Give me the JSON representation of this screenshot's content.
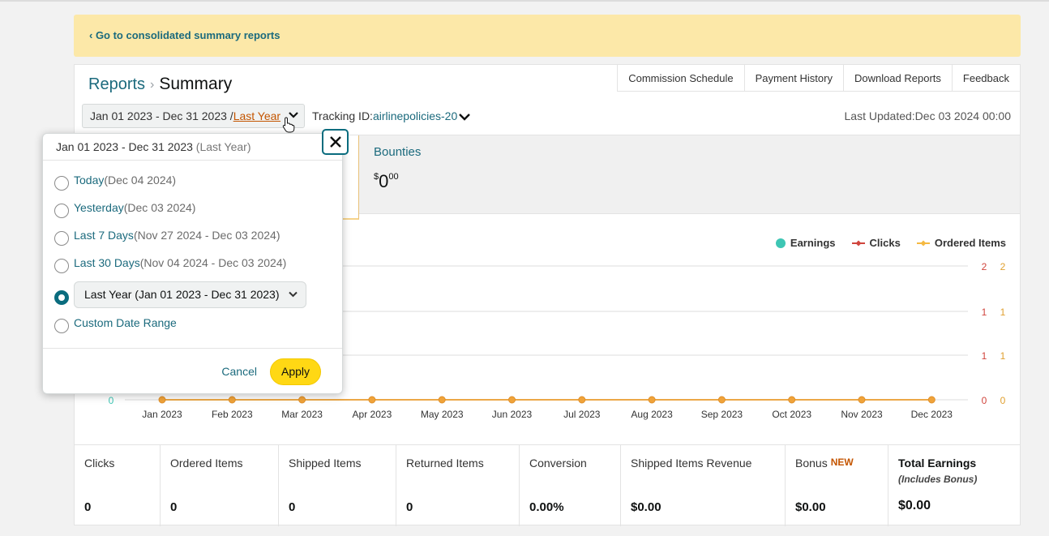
{
  "banner": {
    "link": "‹ Go to consolidated summary reports"
  },
  "breadcrumb": {
    "reports": "Reports",
    "separator": "›",
    "current": "Summary"
  },
  "toplinks": [
    "Commission Schedule",
    "Payment History",
    "Download Reports",
    "Feedback"
  ],
  "date_selector": {
    "range": "Jan 01 2023 - Dec 31 2023 /",
    "preset": "Last Year"
  },
  "tracking": {
    "label": "Tracking ID:",
    "id": "airlinepolicies-20"
  },
  "last_updated": "Last Updated:Dec 03 2024 00:00",
  "bounties": {
    "title": "Bounties",
    "currency": "$",
    "whole": "0",
    "cents": "00"
  },
  "legend": [
    {
      "label": "Earnings",
      "color": "#3ec6b4",
      "icon": "circle-icon"
    },
    {
      "label": "Clicks",
      "color": "#d0453d",
      "icon": "diamond-line-icon"
    },
    {
      "label": "Ordered Items",
      "color": "#f5b942",
      "icon": "diamond-line-icon"
    }
  ],
  "chart_data": {
    "type": "line",
    "categories": [
      "Jan 2023",
      "Feb 2023",
      "Mar 2023",
      "Apr 2023",
      "May 2023",
      "Jun 2023",
      "Jul 2023",
      "Aug 2023",
      "Sep 2023",
      "Oct 2023",
      "Nov 2023",
      "Dec 2023"
    ],
    "series": [
      {
        "name": "Earnings",
        "color": "#3ec6b4",
        "values": [
          0,
          0,
          0,
          0,
          0,
          0,
          0,
          0,
          0,
          0,
          0,
          0
        ]
      },
      {
        "name": "Clicks",
        "color": "#d0453d",
        "values": [
          0,
          0,
          0,
          0,
          0,
          0,
          0,
          0,
          0,
          0,
          0,
          0
        ]
      },
      {
        "name": "Ordered Items",
        "color": "#f5b942",
        "values": [
          0,
          0,
          0,
          0,
          0,
          0,
          0,
          0,
          0,
          0,
          0,
          0
        ]
      }
    ],
    "left_axis_ticks": [
      "0"
    ],
    "right_axis_ticks": [
      {
        "clicks": "2",
        "ordered": "2"
      },
      {
        "clicks": "1",
        "ordered": "1"
      },
      {
        "clicks": "1",
        "ordered": "1"
      },
      {
        "clicks": "0",
        "ordered": "0"
      }
    ],
    "grid": true,
    "legend_position": "top-right"
  },
  "stats": [
    {
      "label": "Clicks",
      "value": "0"
    },
    {
      "label": "Ordered Items",
      "value": "0"
    },
    {
      "label": "Shipped Items",
      "value": "0"
    },
    {
      "label": "Returned Items",
      "value": "0"
    },
    {
      "label": "Conversion",
      "value": "0.00%"
    },
    {
      "label": "Shipped Items Revenue",
      "value": "$0.00"
    },
    {
      "label": "Bonus",
      "badge": "NEW",
      "value": "$0.00"
    },
    {
      "label": "Total Earnings",
      "sub": "(Includes Bonus)",
      "value": "$0.00"
    }
  ],
  "popover": {
    "header_range": "Jan 01 2023 - Dec 31 2023",
    "header_hint": "(Last Year)",
    "options": [
      {
        "name": "Today",
        "range": "(Dec 04 2024)"
      },
      {
        "name": "Yesterday",
        "range": "(Dec 03 2024)"
      },
      {
        "name": "Last 7 Days",
        "range": "(Nov 27 2024 - Dec 03 2024)"
      },
      {
        "name": "Last 30 Days",
        "range": "(Nov 04 2024 - Dec 03 2024)"
      }
    ],
    "selected_select": "Last Year (Jan 01 2023 - Dec 31 2023)",
    "custom": "Custom Date Range",
    "cancel": "Cancel",
    "apply": "Apply"
  }
}
